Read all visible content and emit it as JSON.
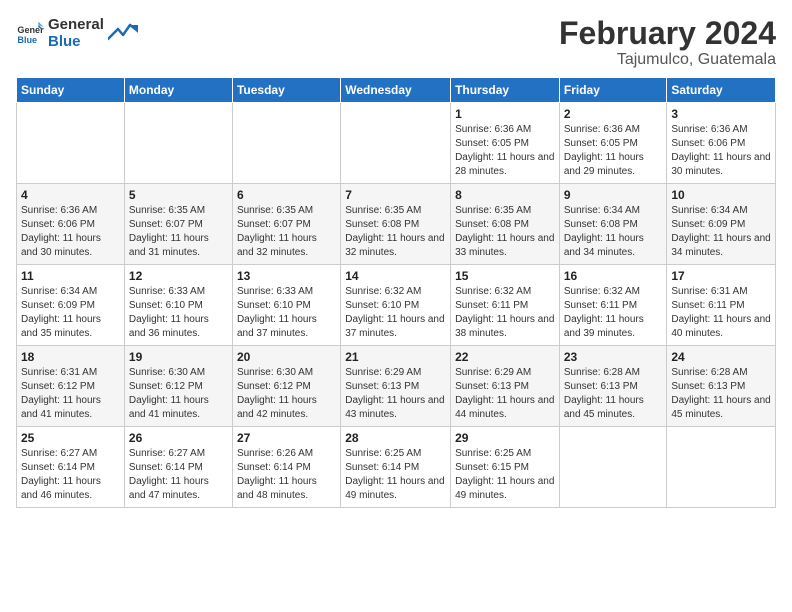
{
  "header": {
    "logo_line1": "General",
    "logo_line2": "Blue",
    "title": "February 2024",
    "subtitle": "Tajumulco, Guatemala"
  },
  "days_of_week": [
    "Sunday",
    "Monday",
    "Tuesday",
    "Wednesday",
    "Thursday",
    "Friday",
    "Saturday"
  ],
  "weeks": [
    [
      {
        "day": "",
        "info": ""
      },
      {
        "day": "",
        "info": ""
      },
      {
        "day": "",
        "info": ""
      },
      {
        "day": "",
        "info": ""
      },
      {
        "day": "1",
        "info": "Sunrise: 6:36 AM\nSunset: 6:05 PM\nDaylight: 11 hours and 28 minutes."
      },
      {
        "day": "2",
        "info": "Sunrise: 6:36 AM\nSunset: 6:05 PM\nDaylight: 11 hours and 29 minutes."
      },
      {
        "day": "3",
        "info": "Sunrise: 6:36 AM\nSunset: 6:06 PM\nDaylight: 11 hours and 30 minutes."
      }
    ],
    [
      {
        "day": "4",
        "info": "Sunrise: 6:36 AM\nSunset: 6:06 PM\nDaylight: 11 hours and 30 minutes."
      },
      {
        "day": "5",
        "info": "Sunrise: 6:35 AM\nSunset: 6:07 PM\nDaylight: 11 hours and 31 minutes."
      },
      {
        "day": "6",
        "info": "Sunrise: 6:35 AM\nSunset: 6:07 PM\nDaylight: 11 hours and 32 minutes."
      },
      {
        "day": "7",
        "info": "Sunrise: 6:35 AM\nSunset: 6:08 PM\nDaylight: 11 hours and 32 minutes."
      },
      {
        "day": "8",
        "info": "Sunrise: 6:35 AM\nSunset: 6:08 PM\nDaylight: 11 hours and 33 minutes."
      },
      {
        "day": "9",
        "info": "Sunrise: 6:34 AM\nSunset: 6:08 PM\nDaylight: 11 hours and 34 minutes."
      },
      {
        "day": "10",
        "info": "Sunrise: 6:34 AM\nSunset: 6:09 PM\nDaylight: 11 hours and 34 minutes."
      }
    ],
    [
      {
        "day": "11",
        "info": "Sunrise: 6:34 AM\nSunset: 6:09 PM\nDaylight: 11 hours and 35 minutes."
      },
      {
        "day": "12",
        "info": "Sunrise: 6:33 AM\nSunset: 6:10 PM\nDaylight: 11 hours and 36 minutes."
      },
      {
        "day": "13",
        "info": "Sunrise: 6:33 AM\nSunset: 6:10 PM\nDaylight: 11 hours and 37 minutes."
      },
      {
        "day": "14",
        "info": "Sunrise: 6:32 AM\nSunset: 6:10 PM\nDaylight: 11 hours and 37 minutes."
      },
      {
        "day": "15",
        "info": "Sunrise: 6:32 AM\nSunset: 6:11 PM\nDaylight: 11 hours and 38 minutes."
      },
      {
        "day": "16",
        "info": "Sunrise: 6:32 AM\nSunset: 6:11 PM\nDaylight: 11 hours and 39 minutes."
      },
      {
        "day": "17",
        "info": "Sunrise: 6:31 AM\nSunset: 6:11 PM\nDaylight: 11 hours and 40 minutes."
      }
    ],
    [
      {
        "day": "18",
        "info": "Sunrise: 6:31 AM\nSunset: 6:12 PM\nDaylight: 11 hours and 41 minutes."
      },
      {
        "day": "19",
        "info": "Sunrise: 6:30 AM\nSunset: 6:12 PM\nDaylight: 11 hours and 41 minutes."
      },
      {
        "day": "20",
        "info": "Sunrise: 6:30 AM\nSunset: 6:12 PM\nDaylight: 11 hours and 42 minutes."
      },
      {
        "day": "21",
        "info": "Sunrise: 6:29 AM\nSunset: 6:13 PM\nDaylight: 11 hours and 43 minutes."
      },
      {
        "day": "22",
        "info": "Sunrise: 6:29 AM\nSunset: 6:13 PM\nDaylight: 11 hours and 44 minutes."
      },
      {
        "day": "23",
        "info": "Sunrise: 6:28 AM\nSunset: 6:13 PM\nDaylight: 11 hours and 45 minutes."
      },
      {
        "day": "24",
        "info": "Sunrise: 6:28 AM\nSunset: 6:13 PM\nDaylight: 11 hours and 45 minutes."
      }
    ],
    [
      {
        "day": "25",
        "info": "Sunrise: 6:27 AM\nSunset: 6:14 PM\nDaylight: 11 hours and 46 minutes."
      },
      {
        "day": "26",
        "info": "Sunrise: 6:27 AM\nSunset: 6:14 PM\nDaylight: 11 hours and 47 minutes."
      },
      {
        "day": "27",
        "info": "Sunrise: 6:26 AM\nSunset: 6:14 PM\nDaylight: 11 hours and 48 minutes."
      },
      {
        "day": "28",
        "info": "Sunrise: 6:25 AM\nSunset: 6:14 PM\nDaylight: 11 hours and 49 minutes."
      },
      {
        "day": "29",
        "info": "Sunrise: 6:25 AM\nSunset: 6:15 PM\nDaylight: 11 hours and 49 minutes."
      },
      {
        "day": "",
        "info": ""
      },
      {
        "day": "",
        "info": ""
      }
    ]
  ]
}
